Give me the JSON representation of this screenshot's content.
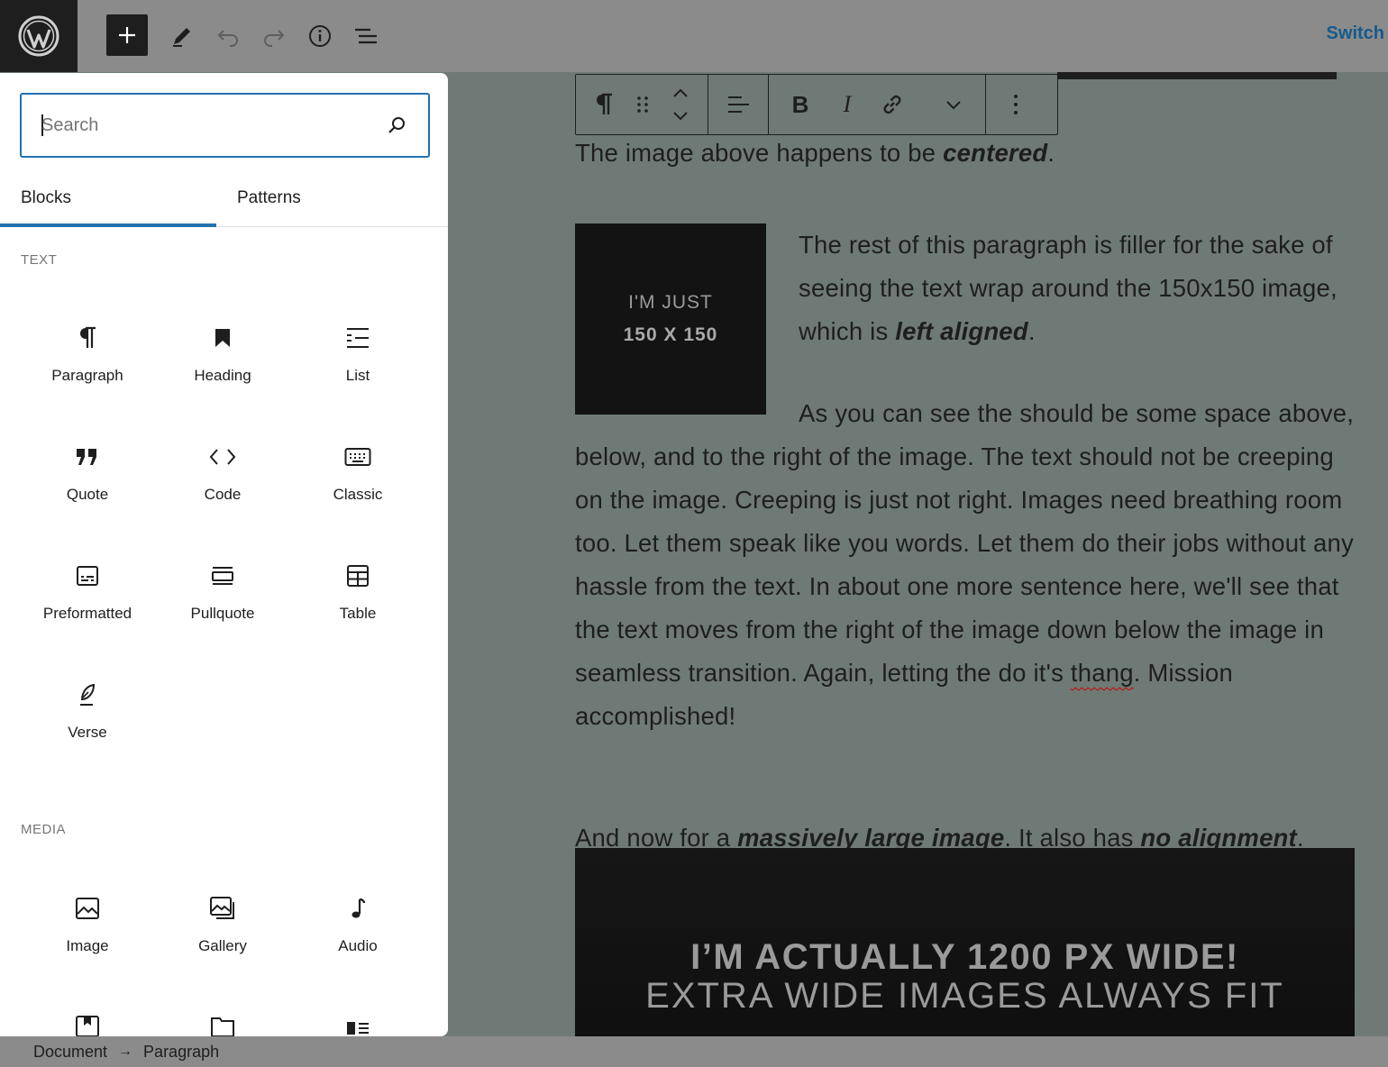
{
  "topbar": {
    "switch_label": "Switch",
    "icons": [
      "wordpress-logo-icon",
      "plus-icon",
      "pencil-icon",
      "undo-icon",
      "redo-icon",
      "info-icon",
      "list-view-icon"
    ]
  },
  "inserter": {
    "search_placeholder": "Search",
    "tabs": [
      {
        "label": "Blocks"
      },
      {
        "label": "Patterns"
      }
    ],
    "sections": [
      {
        "title": "TEXT",
        "blocks": [
          {
            "label": "Paragraph",
            "icon": "paragraph-icon"
          },
          {
            "label": "Heading",
            "icon": "bookmark-icon"
          },
          {
            "label": "List",
            "icon": "list-icon"
          },
          {
            "label": "Quote",
            "icon": "quote-icon"
          },
          {
            "label": "Code",
            "icon": "code-icon"
          },
          {
            "label": "Classic",
            "icon": "keyboard-icon"
          },
          {
            "label": "Preformatted",
            "icon": "preformatted-icon"
          },
          {
            "label": "Pullquote",
            "icon": "pullquote-icon"
          },
          {
            "label": "Table",
            "icon": "table-icon"
          },
          {
            "label": "Verse",
            "icon": "feather-icon"
          }
        ]
      },
      {
        "title": "MEDIA",
        "blocks": [
          {
            "label": "Image",
            "icon": "image-icon"
          },
          {
            "label": "Gallery",
            "icon": "gallery-icon"
          },
          {
            "label": "Audio",
            "icon": "music-note-icon"
          }
        ]
      }
    ]
  },
  "content": {
    "p1_before": "The image above happens to be ",
    "p1_em": "centered",
    "p1_after": ".",
    "img150_line1": "I'M JUST",
    "img150_line2": "150 X 150",
    "p2a_before": "The rest of this paragraph is filler for the sake of seeing the text wrap around the 150x150 image, which is ",
    "p2a_em": "left aligned",
    "p2a_after": ".",
    "p2b_before": "As you can see the should be some space above, below, and to the right of the image. The text should not be creeping on the image. Creeping is just not right. Images need breathing room too. Let them speak like you words. Let them do their jobs without any hassle from the text. In about one more sentence here, we'll see that the text moves from the right of the image down below the image in seamless transition. Again, letting the do it's ",
    "p2b_misspelled": "thang",
    "p2b_after": ". Mission accomplished!",
    "p3_before": "And now for a ",
    "p3_em1": "massively large image",
    "p3_mid": ". It also has ",
    "p3_em2": "no alignment",
    "p3_after": ".",
    "big_img_line1": "I’M ACTUALLY 1200 PX WIDE!",
    "big_img_line2": "EXTRA WIDE IMAGES ALWAYS FIT"
  },
  "block_toolbar": {
    "bold_label": "B",
    "italic_label": "I"
  },
  "footer": {
    "crumb1": "Document",
    "arrow": "→",
    "crumb2": "Paragraph"
  }
}
